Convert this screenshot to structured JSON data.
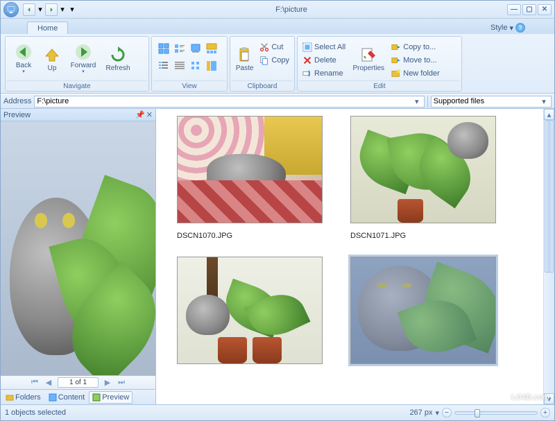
{
  "window": {
    "title": "F:\\picture"
  },
  "tabs": {
    "home": "Home",
    "style": "Style"
  },
  "ribbon": {
    "navigate": {
      "label": "Navigate",
      "back": "Back",
      "up": "Up",
      "forward": "Forward",
      "refresh": "Refresh"
    },
    "view": {
      "label": "View"
    },
    "clipboard": {
      "label": "Clipboard",
      "cut": "Cut",
      "copy": "Copy",
      "paste": "Paste"
    },
    "edit": {
      "label": "Edit",
      "select_all": "Select All",
      "delete": "Delete",
      "rename": "Rename",
      "properties": "Properties",
      "copy_to": "Copy to...",
      "move_to": "Move to...",
      "new_folder": "New folder"
    }
  },
  "address": {
    "label": "Address",
    "value": "F:\\picture",
    "filter": "Supported files"
  },
  "preview": {
    "title": "Preview",
    "pager": "1 of 1",
    "tabs": {
      "folders": "Folders",
      "content": "Content",
      "preview": "Preview"
    }
  },
  "files": [
    {
      "name": "DSCN1070.JPG"
    },
    {
      "name": "DSCN1071.JPG"
    },
    {
      "name": ""
    },
    {
      "name": ""
    }
  ],
  "status": {
    "selection": "1 objects selected",
    "zoom": "267 px"
  },
  "watermark": "LO4D.com"
}
